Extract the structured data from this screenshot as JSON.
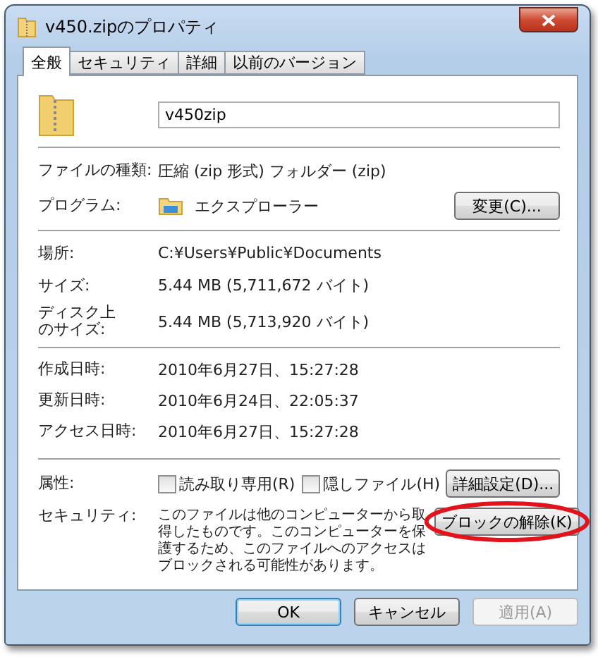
{
  "window": {
    "title": "v450.zipのプロパティ"
  },
  "tabs": [
    {
      "label": "全般",
      "selected": true
    },
    {
      "label": "セキュリティ",
      "selected": false
    },
    {
      "label": "詳細",
      "selected": false
    },
    {
      "label": "以前のバージョン",
      "selected": false
    }
  ],
  "name_field": {
    "value": "v450zip"
  },
  "file_type": {
    "label": "ファイルの種類:",
    "value": "圧縮 (zip 形式) フォルダー (zip)"
  },
  "program": {
    "label": "プログラム:",
    "value": "エクスプローラー",
    "button": "変更(C)..."
  },
  "location_group": [
    {
      "label": "場所:",
      "value": "C:¥Users¥Public¥Documents"
    },
    {
      "label": "サイズ:",
      "value": "5.44 MB (5,711,672 バイト)"
    },
    {
      "label": "ディスク上のサイズ:",
      "value": "5.44 MB (5,713,920 バイト)"
    }
  ],
  "dates": [
    {
      "label": "作成日時:",
      "value": "2010年6月27日、15:27:28"
    },
    {
      "label": "更新日時:",
      "value": "2010年6月24日、22:05:37"
    },
    {
      "label": "アクセス日時:",
      "value": "2010年6月27日、15:27:28"
    }
  ],
  "attributes": {
    "label": "属性:",
    "checkboxes": [
      {
        "label": "読み取り専用(R)",
        "checked": false
      },
      {
        "label": "隠しファイル(H)",
        "checked": false
      }
    ],
    "button": "詳細設定(D)..."
  },
  "security": {
    "label": "セキュリティ:",
    "text": "このファイルは他のコンピューターから取得したものです。このコンピューターを保護するため、このファイルへのアクセスはブロックされる可能性があります。",
    "button": "ブロックの解除(K)",
    "circled": true
  },
  "buttons": [
    {
      "label": "OK",
      "disabled": false,
      "default": true
    },
    {
      "label": "キャンセル",
      "disabled": false,
      "default": false
    },
    {
      "label": "適用(A)",
      "disabled": true,
      "default": false
    }
  ]
}
